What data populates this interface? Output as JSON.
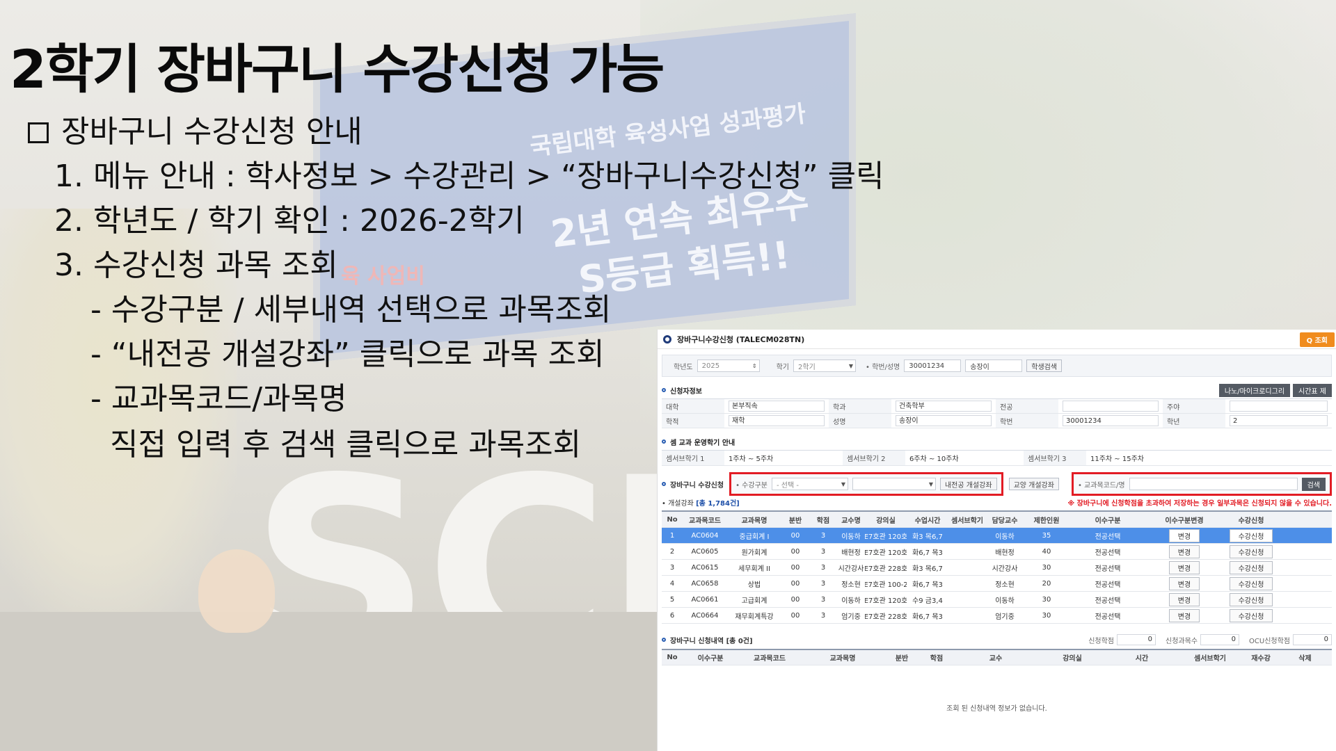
{
  "slide": {
    "title": "2학기 장바구니 수강신청 가능",
    "heading": "장바구니 수강신청 안내",
    "lines": [
      "1. 메뉴 안내 : 학사정보 > 수강관리 > “장바구니수강신청” 클릭",
      "2. 학년도 / 학기 확인 : 2026-2학기",
      "3. 수강신청 과목 조회",
      "- 수강구분 / 세부내역 선택으로 과목조회",
      "- “내전공 개설강좌” 클릭으로 과목 조회",
      "- 교과목코드/과목명",
      "직접 입력 후 검색 클릭으로 과목조회"
    ]
  },
  "background": {
    "billboard_line1": "국립대학 육성사업 성과평가",
    "billboard_line2": "2년 연속 최우수",
    "billboard_line3": "S등급 획득!!",
    "red_text": "육 사업비",
    "big_letters": "SCN"
  },
  "app": {
    "title": "장바구니수강신청 (TALECM028TN)",
    "search_label": "Q 조회",
    "filter": {
      "year_label": "학년도",
      "year_value": "2025",
      "term_label": "학기",
      "term_value": "2학기",
      "student_label": "• 학번/성명",
      "student_id": "30001234",
      "student_name": "송장이",
      "student_search": "학생검색"
    },
    "applicant": {
      "section_title": "신청자정보",
      "btn1": "나노/마이크로디그리",
      "btn2": "시간표 제",
      "fields": [
        {
          "k": "대학",
          "v": "본부직속"
        },
        {
          "k": "학과",
          "v": "건축학부"
        },
        {
          "k": "전공",
          "v": ""
        },
        {
          "k": "주야",
          "v": ""
        },
        {
          "k": "학적",
          "v": "재학"
        },
        {
          "k": "성명",
          "v": "송장이"
        },
        {
          "k": "학번",
          "v": "30001234"
        },
        {
          "k": "학년",
          "v": "2"
        }
      ]
    },
    "semester_info": {
      "section_title": "셈 교과 운영학기 안내",
      "items": [
        {
          "k": "셈서브학기 1",
          "v": "1주차 ~ 5주차"
        },
        {
          "k": "셈서브학기 2",
          "v": "6주차 ~ 10주차"
        },
        {
          "k": "셈서브학기 3",
          "v": "11주차 ~ 15주차"
        }
      ]
    },
    "cart": {
      "section_title": "장바구니 수강신청",
      "category_label": "• 수강구분",
      "category_value": "- 선택 -",
      "detail_value": "",
      "my_major_btn": "내전공 개설강좌",
      "liberal_btn": "교양 개설강좌",
      "code_label": "• 교과목코드/명",
      "code_placeholder": "",
      "search_btn": "검색",
      "count_label": "• 개설강좌",
      "count_value": "[총 1,784건]",
      "warning": "※ 장바구니에 신청학점을 초과하여 저장하는 경우 일부과목은 신청되지 않을 수 있습니다."
    },
    "table": {
      "headers": [
        "No",
        "교과목코드",
        "교과목명",
        "분반",
        "학점",
        "교수명",
        "강의실",
        "수업시간",
        "셈서브학기",
        "담당교수",
        "제한인원",
        "이수구분",
        "이수구분변경",
        "수강신청"
      ],
      "rows": [
        [
          "1",
          "AC0604",
          "중급회계 I",
          "00",
          "3",
          "이동하",
          "E7호관 120호",
          "화3 목6,7",
          "",
          "이동하",
          "35",
          "전공선택",
          "변경",
          "수강신청"
        ],
        [
          "2",
          "AC0605",
          "원가회계",
          "00",
          "3",
          "배현정",
          "E7호관 120호",
          "화6,7 목3",
          "",
          "배현정",
          "40",
          "전공선택",
          "변경",
          "수강신청"
        ],
        [
          "3",
          "AC0615",
          "세무회계 II",
          "00",
          "3",
          "시간강사",
          "E7호관 228호",
          "화3 목6,7",
          "",
          "시간강사",
          "30",
          "전공선택",
          "변경",
          "수강신청"
        ],
        [
          "4",
          "AC0658",
          "상법",
          "00",
          "3",
          "정소현",
          "E7호관 100-2",
          "화6,7 목3",
          "",
          "정소현",
          "20",
          "전공선택",
          "변경",
          "수강신청"
        ],
        [
          "5",
          "AC0661",
          "고급회계",
          "00",
          "3",
          "이동하",
          "E7호관 120호",
          "수9 금3,4",
          "",
          "이동하",
          "30",
          "전공선택",
          "변경",
          "수강신청"
        ],
        [
          "6",
          "AC0664",
          "재무회계특강",
          "00",
          "3",
          "엄기중",
          "E7호관 228호",
          "화6,7 목3",
          "",
          "엄기중",
          "30",
          "전공선택",
          "변경",
          "수강신청"
        ]
      ]
    },
    "cart_list": {
      "section_title": "장바구니 신청내역 [총 0건]",
      "credit_label": "신청학점",
      "credit_value": "0",
      "subject_label": "신청과목수",
      "subject_value": "0",
      "ocu_label": "OCU신청학점",
      "ocu_value": "0",
      "headers": [
        "No",
        "이수구분",
        "교과목코드",
        "교과목명",
        "분반",
        "학점",
        "교수",
        "강의실",
        "시간",
        "셈서브학기",
        "재수강",
        "삭제"
      ],
      "empty_message": "조회 된 신청내역 정보가 없습니다."
    }
  },
  "colors": {
    "accent_red": "#e21c24",
    "selected_row": "#4d8fe8",
    "search_orange": "#f08c1e"
  }
}
